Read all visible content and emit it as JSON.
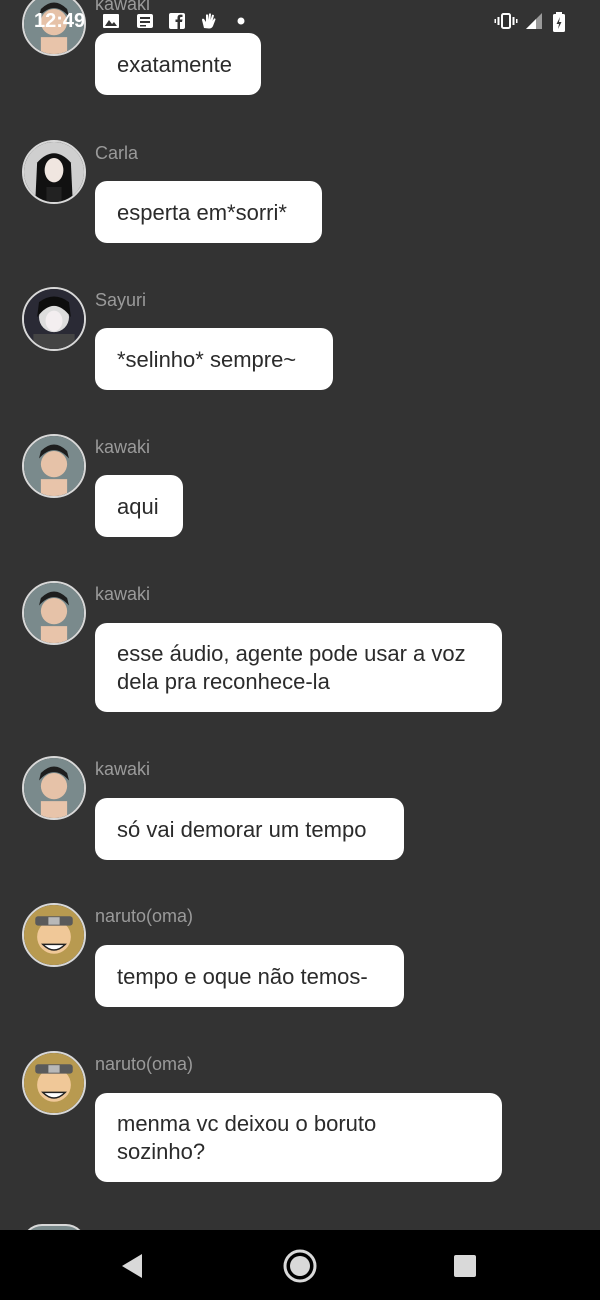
{
  "status_bar": {
    "time": "12:49",
    "left_icons": [
      "image-icon",
      "news-icon",
      "facebook-icon",
      "hand-icon",
      "dot-icon"
    ],
    "right_icons": [
      "vibrate-icon",
      "signal-icon",
      "battery-icon"
    ]
  },
  "messages": [
    {
      "sender": "kawaki",
      "text": "exatamente",
      "avatar": "kawaki-avatar"
    },
    {
      "sender": "Carla",
      "text": "esperta em*sorri*",
      "avatar": "carla-avatar"
    },
    {
      "sender": "Sayuri",
      "text": "*selinho* sempre~",
      "avatar": "sayuri-avatar"
    },
    {
      "sender": "kawaki",
      "text": "aqui",
      "avatar": "kawaki-avatar"
    },
    {
      "sender": "kawaki",
      "text": "esse áudio, agente pode usar a voz\ndela pra reconhece-la",
      "avatar": "kawaki-avatar"
    },
    {
      "sender": "kawaki",
      "text": "só vai demorar um tempo",
      "avatar": "kawaki-avatar"
    },
    {
      "sender": "naruto(oma)",
      "text": "tempo e oque não temos-",
      "avatar": "naruto-avatar"
    },
    {
      "sender": "naruto(oma)",
      "text": "menma vc deixou o boruto\nsozinho?",
      "avatar": "naruto-avatar"
    }
  ],
  "navbar": {
    "back": "back-icon",
    "home": "home-icon",
    "recents": "recents-icon"
  }
}
